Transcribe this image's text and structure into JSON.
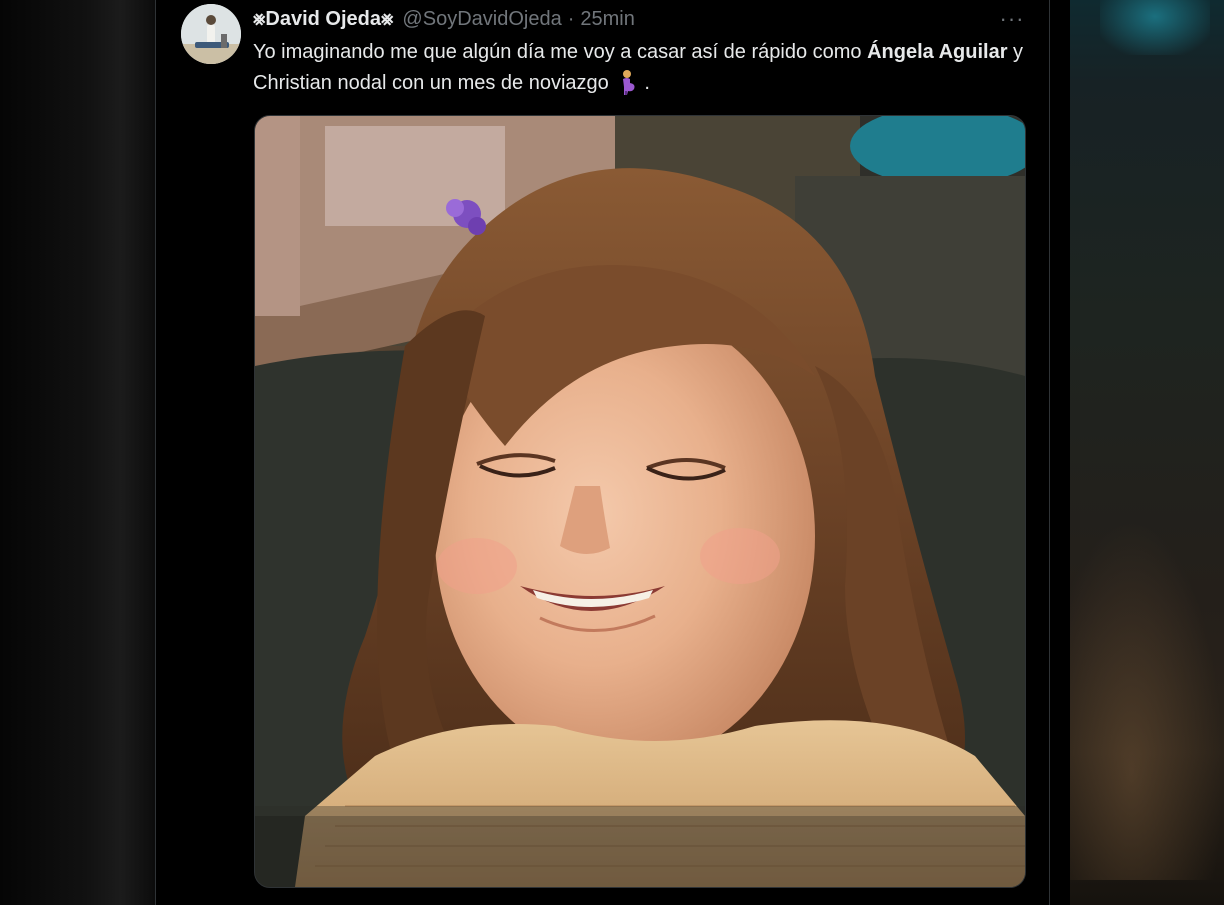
{
  "tweet": {
    "display_name": "David Ojeda",
    "name_badge_icon": "asterisk-cross-symbol",
    "handle": "@SoyDavidOjeda",
    "separator": "·",
    "time": "25min",
    "more_icon": "more-horizontal-icon",
    "more_label": "···",
    "text_part1": "Yo imaginando me que algún día me voy a casar así de rápido como ",
    "text_bold": "Ángela Aguilar",
    "text_part2": " y Christian nodal con un mes de noviazgo",
    "text_end": " .",
    "emoji": "pregnant-woman-emoji",
    "image": "photo of a smiling little girl with closed eyes"
  },
  "colors": {
    "background": "#000000",
    "primary_text": "#e7e9ea",
    "secondary_text": "#71767b",
    "border": "#2f3336"
  }
}
